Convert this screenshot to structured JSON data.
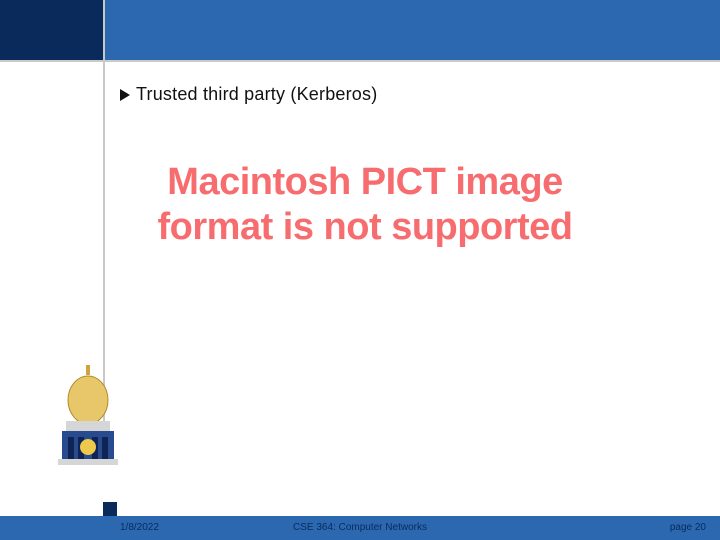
{
  "content": {
    "bullet": "Trusted third party (Kerberos)",
    "center_message": "Macintosh PICT image format is not supported"
  },
  "footer": {
    "date": "1/8/2022",
    "course": "CSE 364: Computer Networks",
    "page": "page 20"
  },
  "colors": {
    "band": "#2b68b0",
    "dark": "#0a2a5c",
    "error": "#f76d6f"
  }
}
